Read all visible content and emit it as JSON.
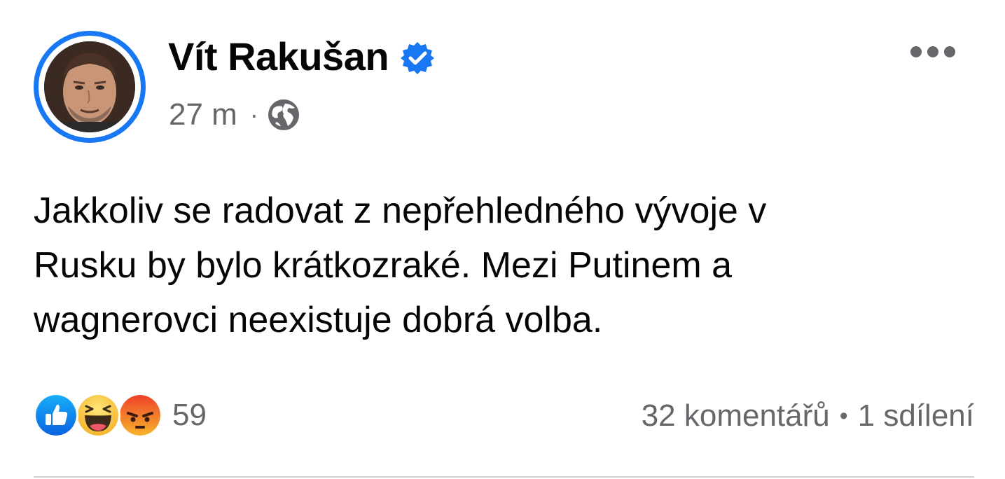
{
  "post": {
    "author": "Vít Rakušan",
    "verified": true,
    "time": "27 m",
    "separator": "·",
    "audience_icon": "globe-icon",
    "body_lines": [
      "Jakkoliv se radovat z nepřehledného vývoje v",
      "Rusku by bylo krátkozraké. Mezi Putinem a",
      "wagnerovci neexistuje dobrá volba."
    ]
  },
  "reactions": {
    "icons": [
      "like-icon",
      "haha-icon",
      "angry-icon"
    ],
    "count": "59"
  },
  "stats": {
    "comments": "32 komentářů",
    "bullet": "•",
    "shares": "1 sdílení"
  },
  "colors": {
    "accent": "#1877f2",
    "secondary_text": "#65676b",
    "primary_text": "#050505"
  }
}
